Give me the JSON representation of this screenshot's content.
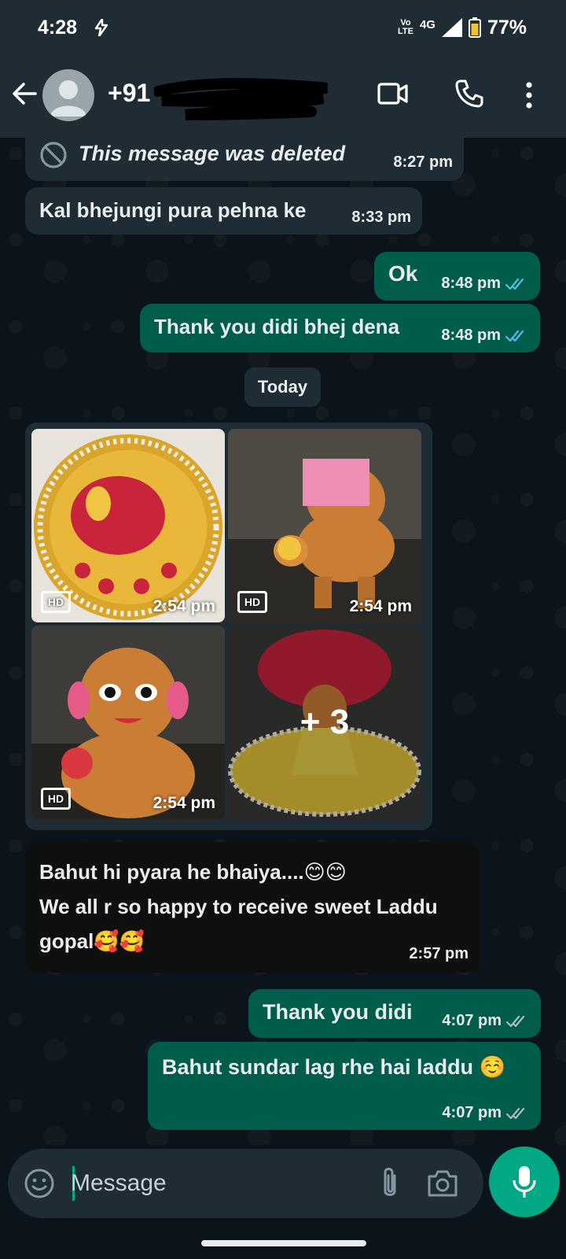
{
  "status_bar": {
    "time": "4:28",
    "volte": "Vo LTE",
    "network": "4G",
    "battery": "77%"
  },
  "header": {
    "contact": "+91"
  },
  "messages": {
    "deleted": {
      "text": "This message was deleted",
      "time": "8:27 pm"
    },
    "m1": {
      "text": "Kal bhejungi pura pehna ke",
      "time": "8:33 pm"
    },
    "m2": {
      "text": "Ok",
      "time": "8:48 pm"
    },
    "m3": {
      "text": "Thank you didi bhej dena",
      "time": "8:48 pm"
    },
    "day": "Today",
    "album": {
      "tiles": [
        {
          "time": "2:54 pm",
          "badge": "HD"
        },
        {
          "time": "2:54 pm",
          "badge": "HD"
        },
        {
          "time": "2:54 pm",
          "badge": "HD"
        },
        {
          "more": "+ 3"
        }
      ]
    },
    "m4": {
      "line1": "Bahut hi pyara he bhaiya....😊😊",
      "line2": "We all r so happy to receive sweet Laddu",
      "line3": "gopal🥰🥰",
      "time": "2:57 pm"
    },
    "m5": {
      "text": "Thank you didi",
      "time": "4:07 pm"
    },
    "m6": {
      "text": "Bahut sundar lag rhe hai laddu ☺️",
      "time": "4:07 pm"
    }
  },
  "composer": {
    "placeholder": "Message"
  },
  "colors": {
    "incoming": "#1f2c34",
    "outgoing": "#005c4b",
    "accent": "#00a884",
    "read_ticks": "#53bdeb"
  }
}
